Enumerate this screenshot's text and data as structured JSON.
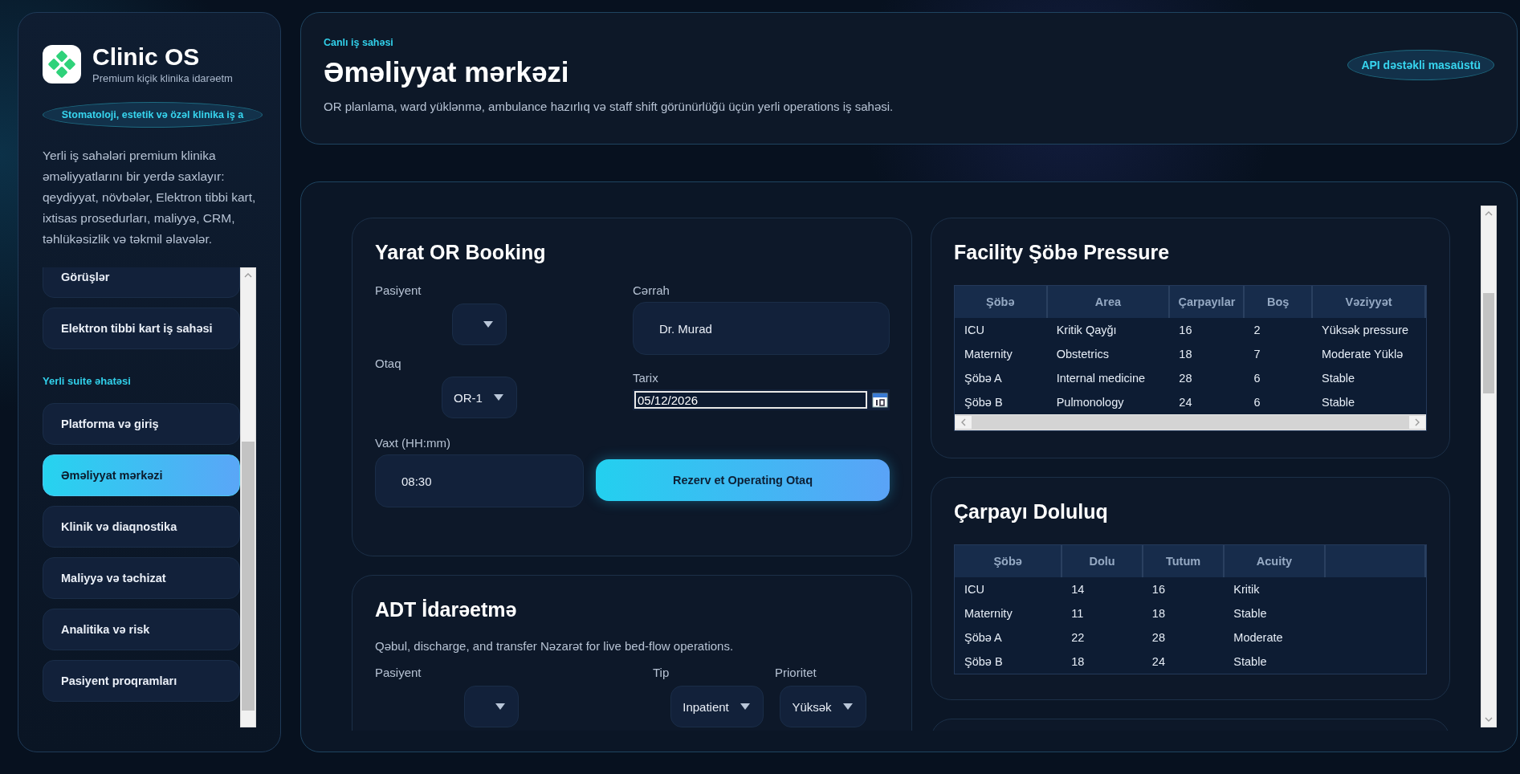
{
  "sidebar": {
    "brand": "Clinic OS",
    "subtitle": "Premium kiçik klinika idarəetm",
    "pill": "Stomatoloji, estetik və özəl klinika iş a",
    "description": "Yerli iş sahələri premium klinika əməliyyatlarını bir yerdə saxlayır: qeydiyyat, növbələr, Elektron tibbi kart, ixtisas prosedurları, maliyyə, CRM, təhlükəsizlik və təkmil əlavələr.",
    "nav": [
      {
        "kind": "item",
        "label": "Görüşlər",
        "selected": false
      },
      {
        "kind": "item",
        "label": "Elektron tibbi kart iş sahəsi",
        "selected": false
      },
      {
        "kind": "heading",
        "label": "Yerli suite əhatəsi"
      },
      {
        "kind": "item",
        "label": "Platforma və giriş",
        "selected": false
      },
      {
        "kind": "item",
        "label": "Əməliyyat mərkəzi",
        "selected": true
      },
      {
        "kind": "item",
        "label": "Klinik və diaqnostika",
        "selected": false
      },
      {
        "kind": "item",
        "label": "Maliyyə və təchizat",
        "selected": false
      },
      {
        "kind": "item",
        "label": "Analitika və risk",
        "selected": false
      },
      {
        "kind": "item",
        "label": "Pasiyent proqramları",
        "selected": false
      }
    ]
  },
  "header": {
    "eyebrow": "Canlı iş sahəsi",
    "title": "Əməliyyat mərkəzi",
    "description": "OR planlama, ward yüklənmə, ambulance hazırlıq və staff shift görünürlüğü üçün yerli operations iş sahəsi.",
    "badge": "API dəstəkli masaüstü"
  },
  "or_booking": {
    "title": "Yarat OR Booking",
    "patient_label": "Pasiyent",
    "room_label": "Otaq",
    "room_value": "OR-1",
    "time_label": "Vaxt (HH:mm)",
    "time_value": "08:30",
    "surgeon_label": "Cərrah",
    "surgeon_value": "Dr. Murad",
    "date_label": "Tarix",
    "date_value": "05/12/2026",
    "button": "Rezerv et Operating Otaq"
  },
  "adt": {
    "title": "ADT İdarəetmə",
    "description": "Qəbul, discharge, and transfer Nəzarət for live bed-flow operations.",
    "patient_label": "Pasiyent",
    "type_label": "Tip",
    "type_value": "Inpatient",
    "priority_label": "Prioritet",
    "priority_value": "Yüksək"
  },
  "facility": {
    "title": "Facility Şöbə Pressure",
    "columns": [
      "Şöbə",
      "Area",
      "Çarpayılar",
      "Boş",
      "Vəziyyət"
    ],
    "rows": [
      [
        "ICU",
        "Kritik Qayğı",
        "16",
        "2",
        "Yüksək pressure"
      ],
      [
        "Maternity",
        "Obstetrics",
        "18",
        "7",
        "Moderate Yüklə"
      ],
      [
        "Şöbə A",
        "Internal medicine",
        "28",
        "6",
        "Stable"
      ],
      [
        "Şöbə B",
        "Pulmonology",
        "24",
        "6",
        "Stable"
      ]
    ]
  },
  "occupancy": {
    "title": "Çarpayı Doluluq",
    "columns": [
      "Şöbə",
      "Dolu",
      "Tutum",
      "Acuity"
    ],
    "rows": [
      [
        "ICU",
        "14",
        "16",
        "Kritik"
      ],
      [
        "Maternity",
        "11",
        "18",
        "Stable"
      ],
      [
        "Şöbə A",
        "22",
        "28",
        "Moderate"
      ],
      [
        "Şöbə B",
        "18",
        "24",
        "Stable"
      ]
    ]
  }
}
